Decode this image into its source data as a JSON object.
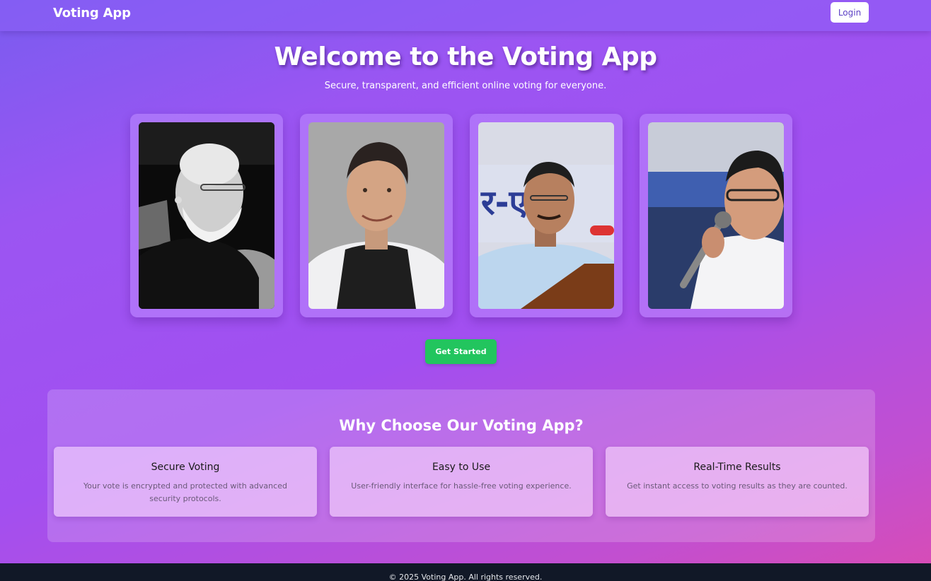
{
  "navbar": {
    "brand": "Voting App",
    "login_label": "Login"
  },
  "hero": {
    "title": "Welcome to the Voting App",
    "subtitle": "Secure, transparent, and efficient online voting for everyone."
  },
  "candidates": [
    {
      "photo": "candidate-photo-1"
    },
    {
      "photo": "candidate-photo-2"
    },
    {
      "photo": "candidate-photo-3"
    },
    {
      "photo": "candidate-photo-4"
    }
  ],
  "cta": {
    "label": "Get Started",
    "color": "#22c55e"
  },
  "features": {
    "title": "Why Choose Our Voting App?",
    "items": [
      {
        "title": "Secure Voting",
        "description": "Your vote is encrypted and protected with advanced security protocols."
      },
      {
        "title": "Easy to Use",
        "description": "User-friendly interface for hassle-free voting experience."
      },
      {
        "title": "Real-Time Results",
        "description": "Get instant access to voting results as they are counted."
      }
    ]
  },
  "footer": {
    "text": "© 2025 Voting App. All rights reserved."
  },
  "colors": {
    "gradient_start": "#7a5cf0",
    "gradient_end": "#d94cb4",
    "footer_bg": "#111827"
  }
}
